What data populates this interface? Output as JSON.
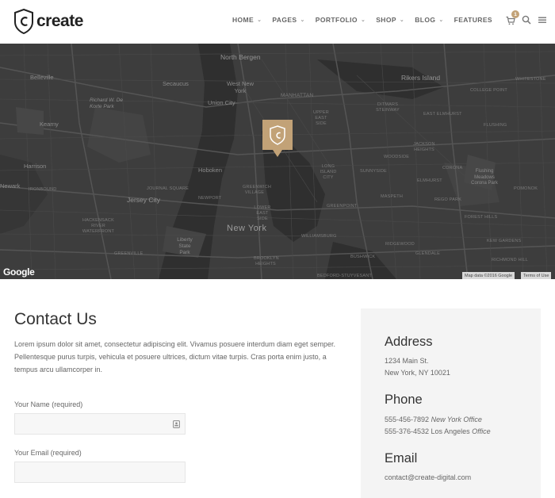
{
  "brand": {
    "name": "create",
    "accent": "#c2a277"
  },
  "nav": {
    "items": [
      {
        "label": "HOME",
        "dropdown": true
      },
      {
        "label": "PAGES",
        "dropdown": true
      },
      {
        "label": "PORTFOLIO",
        "dropdown": true
      },
      {
        "label": "SHOP",
        "dropdown": true
      },
      {
        "label": "BLOG",
        "dropdown": true
      },
      {
        "label": "FEATURES",
        "dropdown": false
      }
    ],
    "cart_count": "1",
    "icons": [
      "cart-icon",
      "search-icon",
      "menu-icon"
    ]
  },
  "map": {
    "labels": {
      "north_bergen": "North Bergen",
      "rikers": "Rikers Island",
      "whitestone": "WHITESTONE",
      "belleville": "Belleville",
      "secaucus": "Secaucus",
      "west_new_york": "West New York",
      "manhattan": "MANHATTAN",
      "college_point": "COLLEGE POINT",
      "richard": "Richard W. De Korte Park",
      "union_city": "Union City",
      "upper_east": "UPPER EAST SIDE",
      "ditmars": "DITMARS STEINWAY",
      "east_elmhurst": "EAST ELMHURST",
      "kearny": "Kearny",
      "flushing": "FLUSHING",
      "jackson": "JACKSON HEIGHTS",
      "harrison": "Harrison",
      "hoboken": "Hoboken",
      "long_island_city": "LONG ISLAND CITY",
      "sunnyside": "SUNNYSIDE",
      "woodside": "WOODSIDE",
      "corona": "CORONA",
      "flushing_meadows": "Flushing Meadows Corona Park",
      "newark": "Newark",
      "ironbound": "IRONBOUND",
      "greenwich": "GREENWICH VILLAGE",
      "elmhurst": "ELMHURST",
      "pomonok": "POMONOK",
      "jersey_city": "Jersey City",
      "journal_square": "JOURNAL SQUARE",
      "newport": "NEWPORT",
      "lower_east": "LOWER EAST SIDE",
      "maspeth": "MASPETH",
      "greenpoint": "GREENPOINT",
      "rego_park": "REGO PARK",
      "new_york": "New York",
      "hackensack": "HACKENSACK RIVER WATERFRONT",
      "williamsburg": "WILLIAMSBURG",
      "forest_hills": "FOREST HILLS",
      "liberty": "Liberty State Park",
      "kew_gardens": "KEW GARDENS",
      "ridgewood": "RIDGEWOOD",
      "greenville": "GREENVILLE",
      "glendale": "GLENDALE",
      "richmond_hill": "RICHMOND HILL",
      "brooklyn_heights": "BROOKLYN HEIGHTS",
      "bushwick": "BUSHWICK",
      "bedford": "BEDFORD-STUYVESANT",
      "google": "Google",
      "map_data": "Map data ©2016 Google",
      "terms": "Terms of Use"
    }
  },
  "contact": {
    "title": "Contact Us",
    "body": "Lorem ipsum dolor sit amet, consectetur adipiscing elit. Vivamus posuere interdum diam eget semper. Pellentesque purus turpis, vehicula et posuere ultrices, dictum vitae turpis. Cras porta enim justo, a tempus arcu ullamcorper in.",
    "name_label": "Your Name (required)",
    "name_value": "",
    "email_label": "Your Email (required)",
    "email_value": ""
  },
  "info": {
    "address_title": "Address",
    "address_line1": "1234 Main St.",
    "address_line2": "New York, NY 10021",
    "phone_title": "Phone",
    "phone1_number": "555-456-7892",
    "phone1_label": "New York Office",
    "phone2_number": "555-376-4532 Los Angeles",
    "phone2_label": "Office",
    "email_title": "Email",
    "email": "contact@create-digital.com"
  }
}
